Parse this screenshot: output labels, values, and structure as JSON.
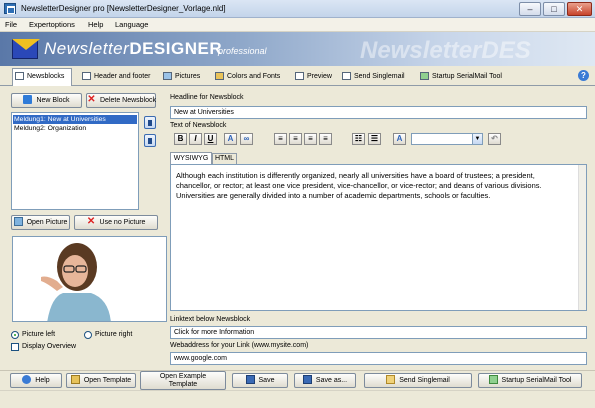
{
  "window": {
    "title": "NewsletterDesigner pro [NewsletterDesigner_Vorlage.nld]",
    "controls": {
      "minimize": "–",
      "maximize": "□",
      "close": "✕"
    }
  },
  "menu": {
    "items": [
      "File",
      "Expertoptions",
      "Help",
      "Language"
    ]
  },
  "banner": {
    "logo_prefix": "Newsletter",
    "logo_bold": "DESIGNER",
    "edition": "professional",
    "ghost": "NewsletterDES"
  },
  "tabs": [
    {
      "label": "Newsblocks",
      "icon": "table-icon",
      "active": true
    },
    {
      "label": "Header and footer",
      "icon": "header-icon"
    },
    {
      "label": "Pictures",
      "icon": "picture-icon"
    },
    {
      "label": "Colors and Fonts",
      "icon": "palette-icon"
    },
    {
      "label": "Preview",
      "icon": "preview-icon"
    },
    {
      "label": "Send Singlemail",
      "icon": "send-icon"
    },
    {
      "label": "Startup SerialMail Tool",
      "icon": "serialmail-icon"
    }
  ],
  "help_icon": "?",
  "left": {
    "new_block": "New Block",
    "delete_block": "Delete Newsblock",
    "blocks": [
      "Meldung1:  New at Universities",
      "Meldung2:  Organization"
    ],
    "open_picture": "Open Picture",
    "use_no_picture": "Use no Picture",
    "picture_left": "Picture left",
    "picture_right": "Picture right",
    "display_overview": "Display Overview",
    "picture_left_selected": true
  },
  "right": {
    "headline_label": "Headline for Newsblock",
    "headline_value": "New at Universities",
    "text_label": "Text of Newsblock",
    "format_buttons": {
      "bold": "B",
      "italic": "I",
      "underline": "U",
      "undo": "↶"
    },
    "editor_tabs": [
      "WYSIWYG",
      "HTML"
    ],
    "editor_text": "Although each institution is differently organized, nearly all universities have a board of trustees; a president, chancellor, or rector; at least one vice president, vice-chancellor, or vice-rector; and deans of various divisions. Universities are generally divided into a number of academic departments, schools or faculties.",
    "linktext_label": "Linktext below Newsblock",
    "linktext_value": "Click for more Information",
    "webaddress_label": "Webaddress for your Link (www.mysite.com)",
    "webaddress_value": "www.google.com"
  },
  "bottom": {
    "help": "Help",
    "open_template": "Open Template",
    "open_example_template": "Open Example\nTemplate",
    "save": "Save",
    "save_as": "Save as...",
    "send_singlemail": "Send Singlemail",
    "startup_serialmail": "Startup SerialMail Tool"
  }
}
